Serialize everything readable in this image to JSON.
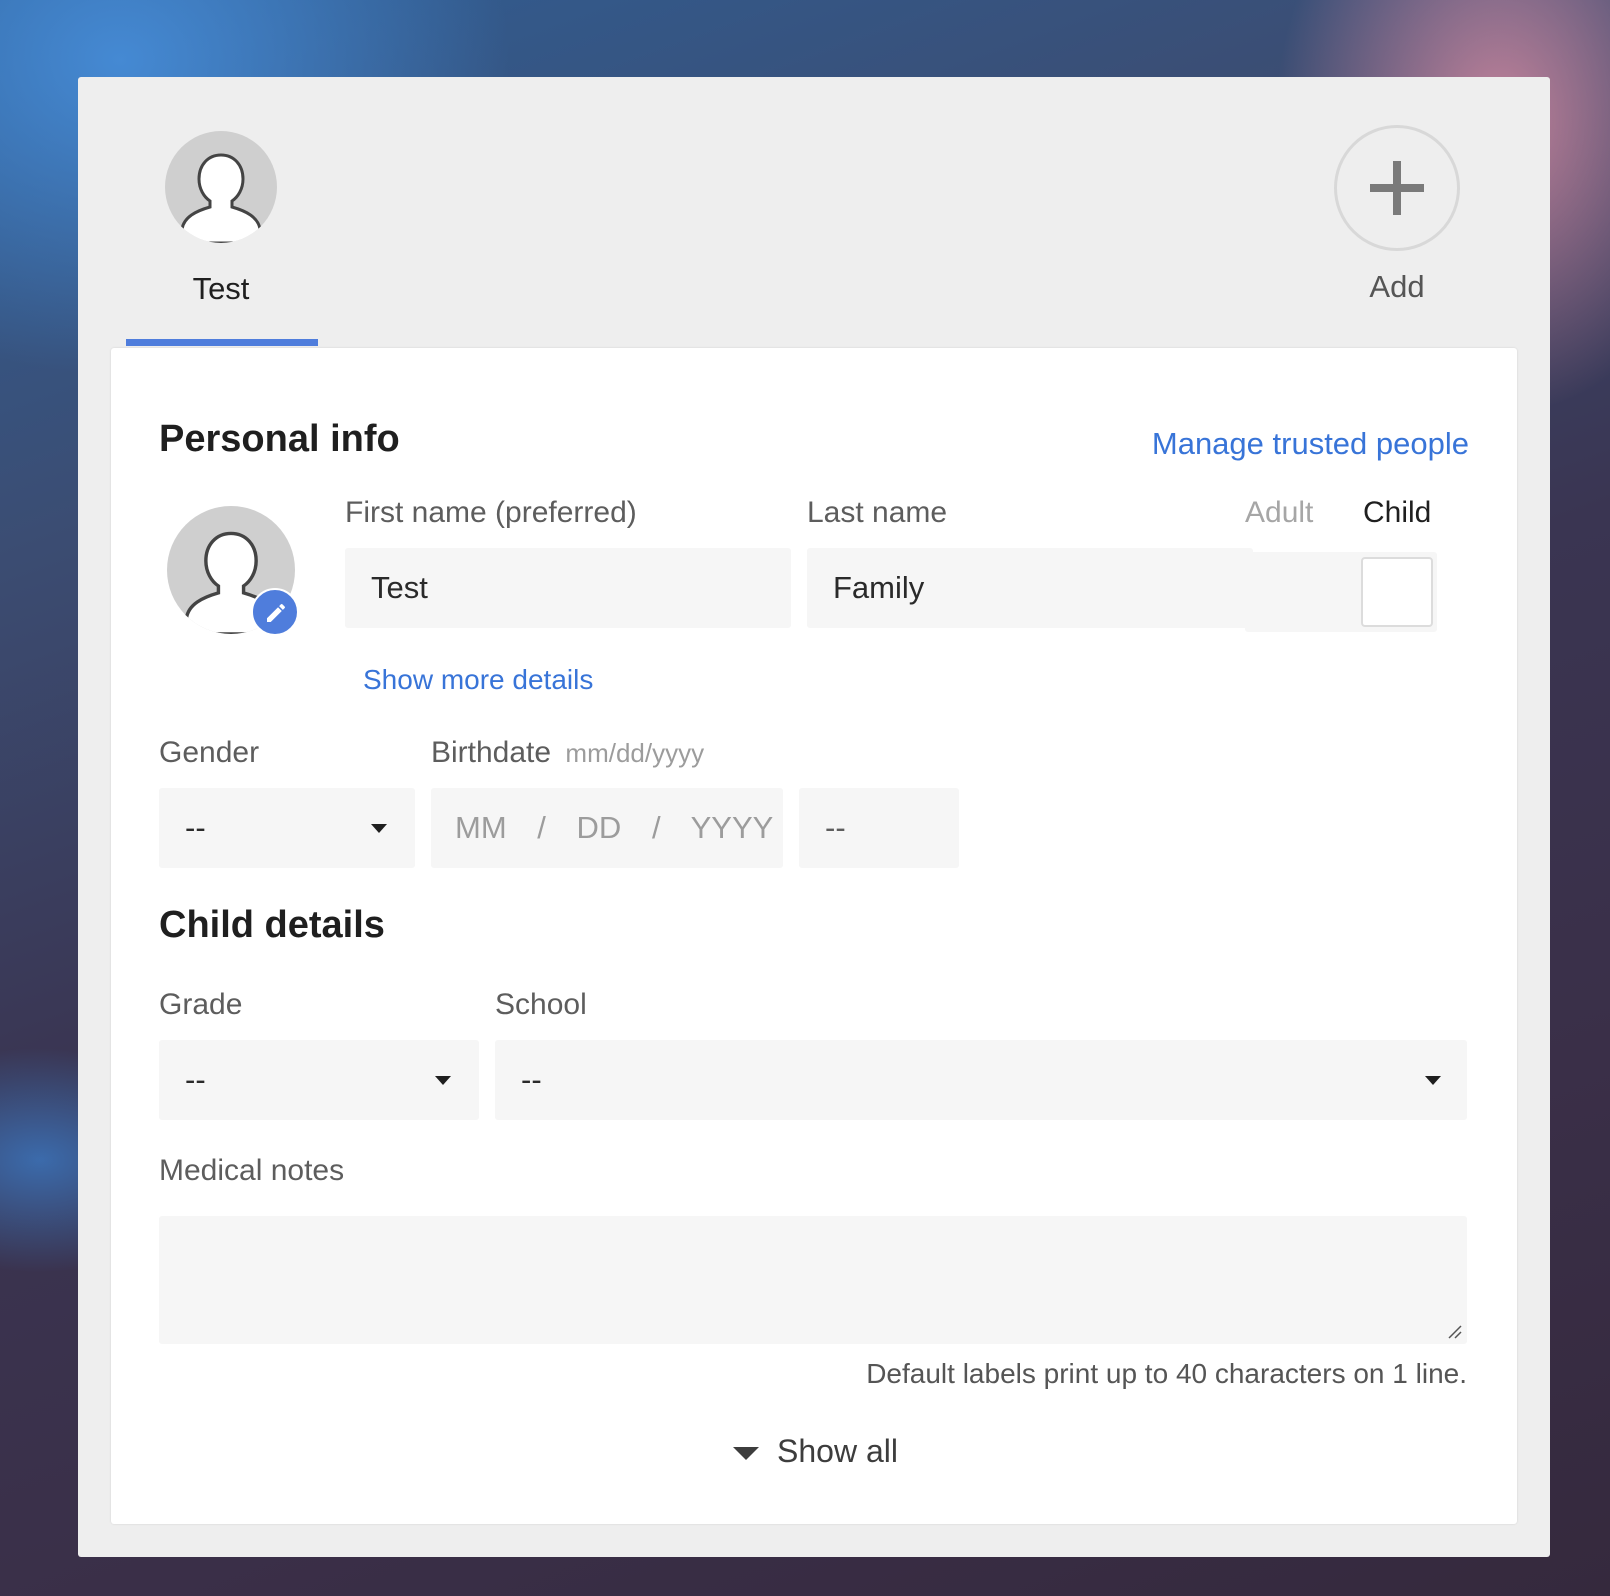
{
  "tabs": {
    "person": {
      "name": "Test"
    },
    "add": {
      "label": "Add"
    }
  },
  "personal_info": {
    "title": "Personal info",
    "manage_link": "Manage trusted people",
    "first_name_label": "First name (preferred)",
    "first_name_value": "Test",
    "last_name_label": "Last name",
    "last_name_value": "Family",
    "adult_label": "Adult",
    "child_label": "Child",
    "show_more_link": "Show more details",
    "gender_label": "Gender",
    "gender_value": "--",
    "birthdate_label": "Birthdate",
    "birthdate_format": "mm/dd/yyyy",
    "birth_mm": "MM",
    "birth_dd": "DD",
    "birth_yyyy": "YYYY",
    "birth_sep": "/",
    "age_value": "--"
  },
  "child_details": {
    "title": "Child details",
    "grade_label": "Grade",
    "grade_value": "--",
    "school_label": "School",
    "school_value": "--",
    "medical_label": "Medical notes",
    "medical_value": "",
    "hint": "Default labels print up to 40 characters on 1 line.",
    "show_all": "Show all"
  },
  "colors": {
    "accent": "#4f7ddc",
    "link": "#3874d8",
    "field_bg": "#f6f6f6",
    "panel_bg": "#eeeeee"
  },
  "icons": [
    "person-icon",
    "plus-icon",
    "pencil-icon",
    "chevron-down-icon",
    "resize-handle-icon"
  ]
}
